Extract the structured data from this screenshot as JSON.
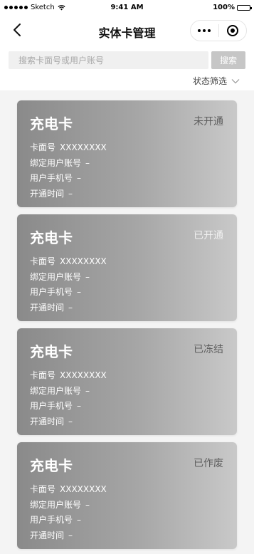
{
  "status_bar": {
    "carrier": "Sketch",
    "time": "9:41 AM",
    "battery": "100%"
  },
  "nav": {
    "title": "实体卡管理"
  },
  "search": {
    "placeholder": "搜索卡面号或用户账号",
    "button_label": "搜索"
  },
  "filter": {
    "label": "状态筛选"
  },
  "cards": [
    {
      "title": "充电卡",
      "status": "未开通",
      "status_tone": "grey",
      "card_no_label": "卡面号",
      "card_no_value": "XXXXXXXX",
      "account_label": "绑定用户账号",
      "account_value": "–",
      "phone_label": "用户手机号",
      "phone_value": "–",
      "time_label": "开通时间",
      "time_value": "–"
    },
    {
      "title": "充电卡",
      "status": "已开通",
      "status_tone": "light",
      "card_no_label": "卡面号",
      "card_no_value": "XXXXXXXX",
      "account_label": "绑定用户账号",
      "account_value": "–",
      "phone_label": "用户手机号",
      "phone_value": "–",
      "time_label": "开通时间",
      "time_value": "–"
    },
    {
      "title": "充电卡",
      "status": "已冻结",
      "status_tone": "grey",
      "card_no_label": "卡面号",
      "card_no_value": "XXXXXXXX",
      "account_label": "绑定用户账号",
      "account_value": "–",
      "phone_label": "用户手机号",
      "phone_value": "–",
      "time_label": "开通时间",
      "time_value": "–"
    },
    {
      "title": "充电卡",
      "status": "已作废",
      "status_tone": "grey",
      "card_no_label": "卡面号",
      "card_no_value": "XXXXXXXX",
      "account_label": "绑定用户账号",
      "account_value": "–",
      "phone_label": "用户手机号",
      "phone_value": "–",
      "time_label": "开通时间",
      "time_value": "–"
    }
  ],
  "icons": {
    "back": "chevron-left-icon",
    "more": "more-dots-icon",
    "close": "target-circle-icon",
    "filter": "chevron-down-icon"
  }
}
